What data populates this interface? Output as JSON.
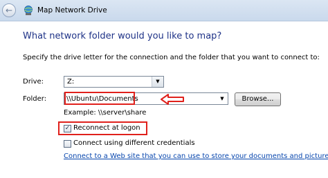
{
  "window": {
    "title": "Map Network Drive"
  },
  "heading": "What network folder would you like to map?",
  "instruction": "Specify the drive letter for the connection and the folder that you want to connect to:",
  "drive": {
    "label": "Drive:",
    "value": "Z:"
  },
  "folder": {
    "label": "Folder:",
    "value": "\\\\Ubuntu\\Documents"
  },
  "browse_label": "Browse...",
  "example": "Example: \\\\server\\share",
  "reconnect": {
    "label": "Reconnect at logon",
    "checked": true
  },
  "credentials": {
    "label": "Connect using different credentials",
    "checked": false
  },
  "web_link": "Connect to a Web site that you can use to store your documents and pictures.",
  "colors": {
    "heading": "#1e3287",
    "annotation": "#e0201b",
    "link": "#0645ad"
  },
  "icons": {
    "back": "back-arrow-icon",
    "app": "network-drive-icon"
  }
}
